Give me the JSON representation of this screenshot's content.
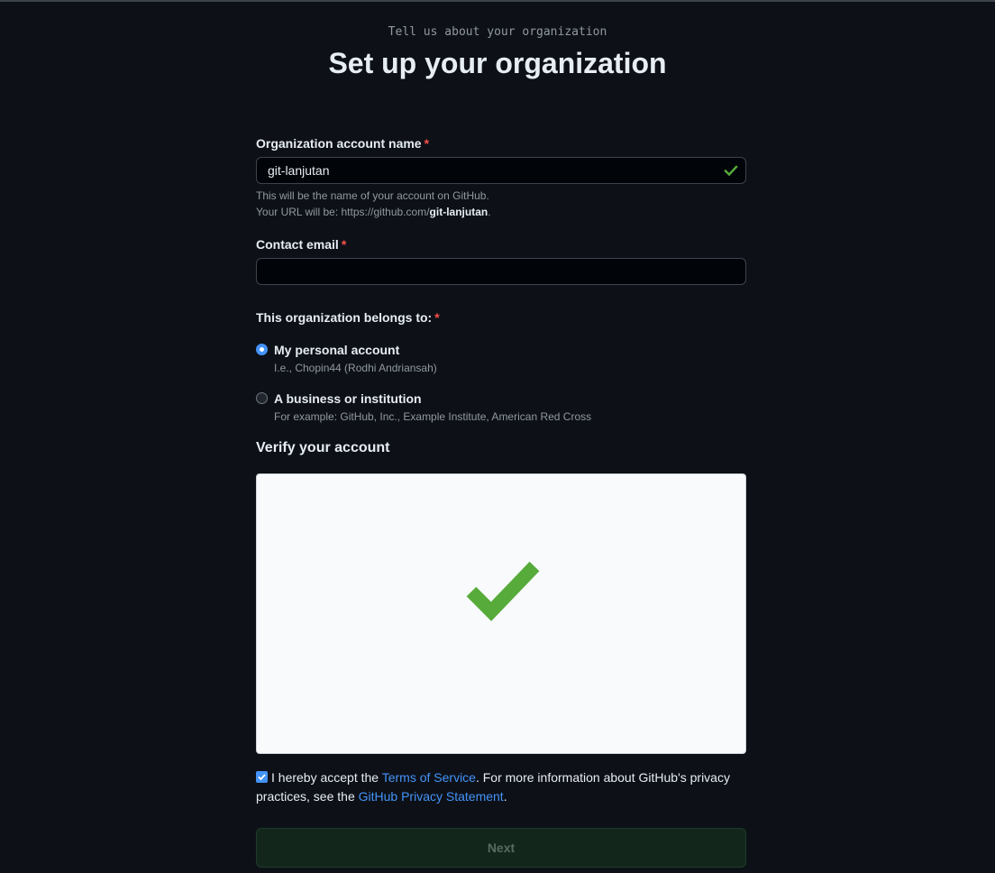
{
  "header": {
    "eyebrow": "Tell us about your organization",
    "title": "Set up your organization"
  },
  "org_name": {
    "label": "Organization account name",
    "required_mark": "*",
    "value": "git-lanjutan",
    "note_line1": "This will be the name of your account on GitHub.",
    "note_url_prefix": "Your URL will be: https://github.com/",
    "note_url_name": "git-lanjutan",
    "note_url_suffix": "."
  },
  "contact_email": {
    "label": "Contact email",
    "required_mark": "*",
    "value": ""
  },
  "belongs_to": {
    "label": "This organization belongs to:",
    "required_mark": "*",
    "options": [
      {
        "title": "My personal account",
        "description": "I.e., Chopin44 (Rodhi Andriansah)",
        "selected": true
      },
      {
        "title": "A business or institution",
        "description": "For example: GitHub, Inc., Example Institute, American Red Cross",
        "selected": false
      }
    ]
  },
  "verify": {
    "title": "Verify your account"
  },
  "terms": {
    "checked": true,
    "text_before": "I hereby accept the ",
    "tos_link": "Terms of Service",
    "text_middle": ". For more information about GitHub's privacy practices, see the ",
    "privacy_link": "GitHub Privacy Statement",
    "text_after": "."
  },
  "next_button": {
    "label": "Next"
  },
  "colors": {
    "background": "#0d1117",
    "accent": "#4493f8",
    "success": "#57ab3a",
    "danger": "#f85149"
  },
  "icons": {
    "valid": "check-icon",
    "captcha_success": "big-check-icon"
  }
}
